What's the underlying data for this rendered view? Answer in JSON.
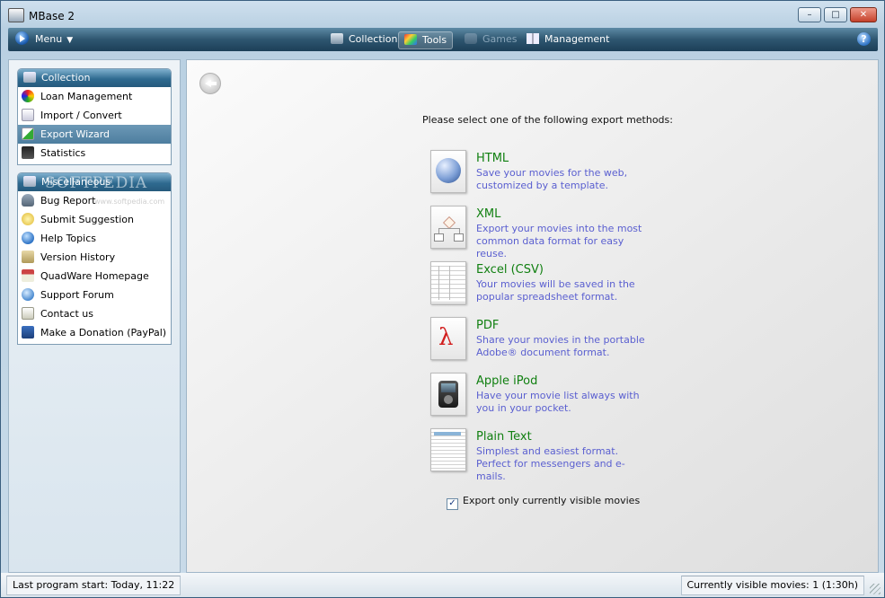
{
  "window": {
    "title": "MBase 2"
  },
  "window_buttons": {
    "minimize": "–",
    "maximize": "□",
    "close": "✕"
  },
  "toolbar": {
    "menu_label": "Menu",
    "tabs": [
      {
        "label": "Collection",
        "state": "normal"
      },
      {
        "label": "Tools",
        "state": "active"
      },
      {
        "label": "Games",
        "state": "disabled"
      },
      {
        "label": "Management",
        "state": "normal"
      }
    ],
    "help_label": "?"
  },
  "sidebar": {
    "collection_panel": {
      "title": "Collection",
      "items": [
        {
          "label": "Loan Management",
          "icon": "loan-icon"
        },
        {
          "label": "Import / Convert",
          "icon": "import-icon"
        },
        {
          "label": "Export Wizard",
          "icon": "export-icon",
          "selected": true
        },
        {
          "label": "Statistics",
          "icon": "statistics-icon"
        }
      ]
    },
    "misc_panel": {
      "title": "Miscellaneous",
      "items": [
        {
          "label": "Bug Report",
          "icon": "bug-report-icon"
        },
        {
          "label": "Submit Suggestion",
          "icon": "suggestion-icon"
        },
        {
          "label": "Help Topics",
          "icon": "help-topics-icon"
        },
        {
          "label": "Version History",
          "icon": "version-history-icon"
        },
        {
          "label": "QuadWare Homepage",
          "icon": "homepage-icon"
        },
        {
          "label": "Support Forum",
          "icon": "support-forum-icon"
        },
        {
          "label": "Contact us",
          "icon": "contact-icon"
        },
        {
          "label": "Make a Donation (PayPal)",
          "icon": "donation-icon"
        }
      ]
    },
    "watermark": "SOFTPEDIA",
    "watermark_url": "www.softpedia.com"
  },
  "main": {
    "prompt": "Please select one of the following export methods:",
    "export_methods": [
      {
        "title": "HTML",
        "description": "Save your movies for the web, customized by a template.",
        "icon": "globe-icon"
      },
      {
        "title": "XML",
        "description": "Export your movies into the most common data format for easy reuse.",
        "icon": "xml-tree-icon"
      },
      {
        "title": "Excel (CSV)",
        "description": "Your movies will be saved in the popular spreadsheet format.",
        "icon": "spreadsheet-icon"
      },
      {
        "title": "PDF",
        "description": "Share your movies in the portable Adobe® document format.",
        "icon": "pdf-icon"
      },
      {
        "title": "Apple iPod",
        "description": "Have your movie list always with you in your pocket.",
        "icon": "ipod-icon"
      },
      {
        "title": "Plain Text",
        "description": "Simplest and easiest format. Perfect for messengers and e-mails.",
        "icon": "text-document-icon"
      }
    ],
    "checkbox": {
      "label": "Export only currently visible movies",
      "checked": true,
      "mark": "✓"
    }
  },
  "statusbar": {
    "left": "Last program start: Today, 11:22",
    "right": "Currently visible movies: 1 (1:30h)"
  },
  "colors": {
    "export_title": "#118011",
    "export_desc": "#5a5fd0",
    "toolbar_bg": "#2e5670",
    "selection": "#4d7e9f"
  }
}
